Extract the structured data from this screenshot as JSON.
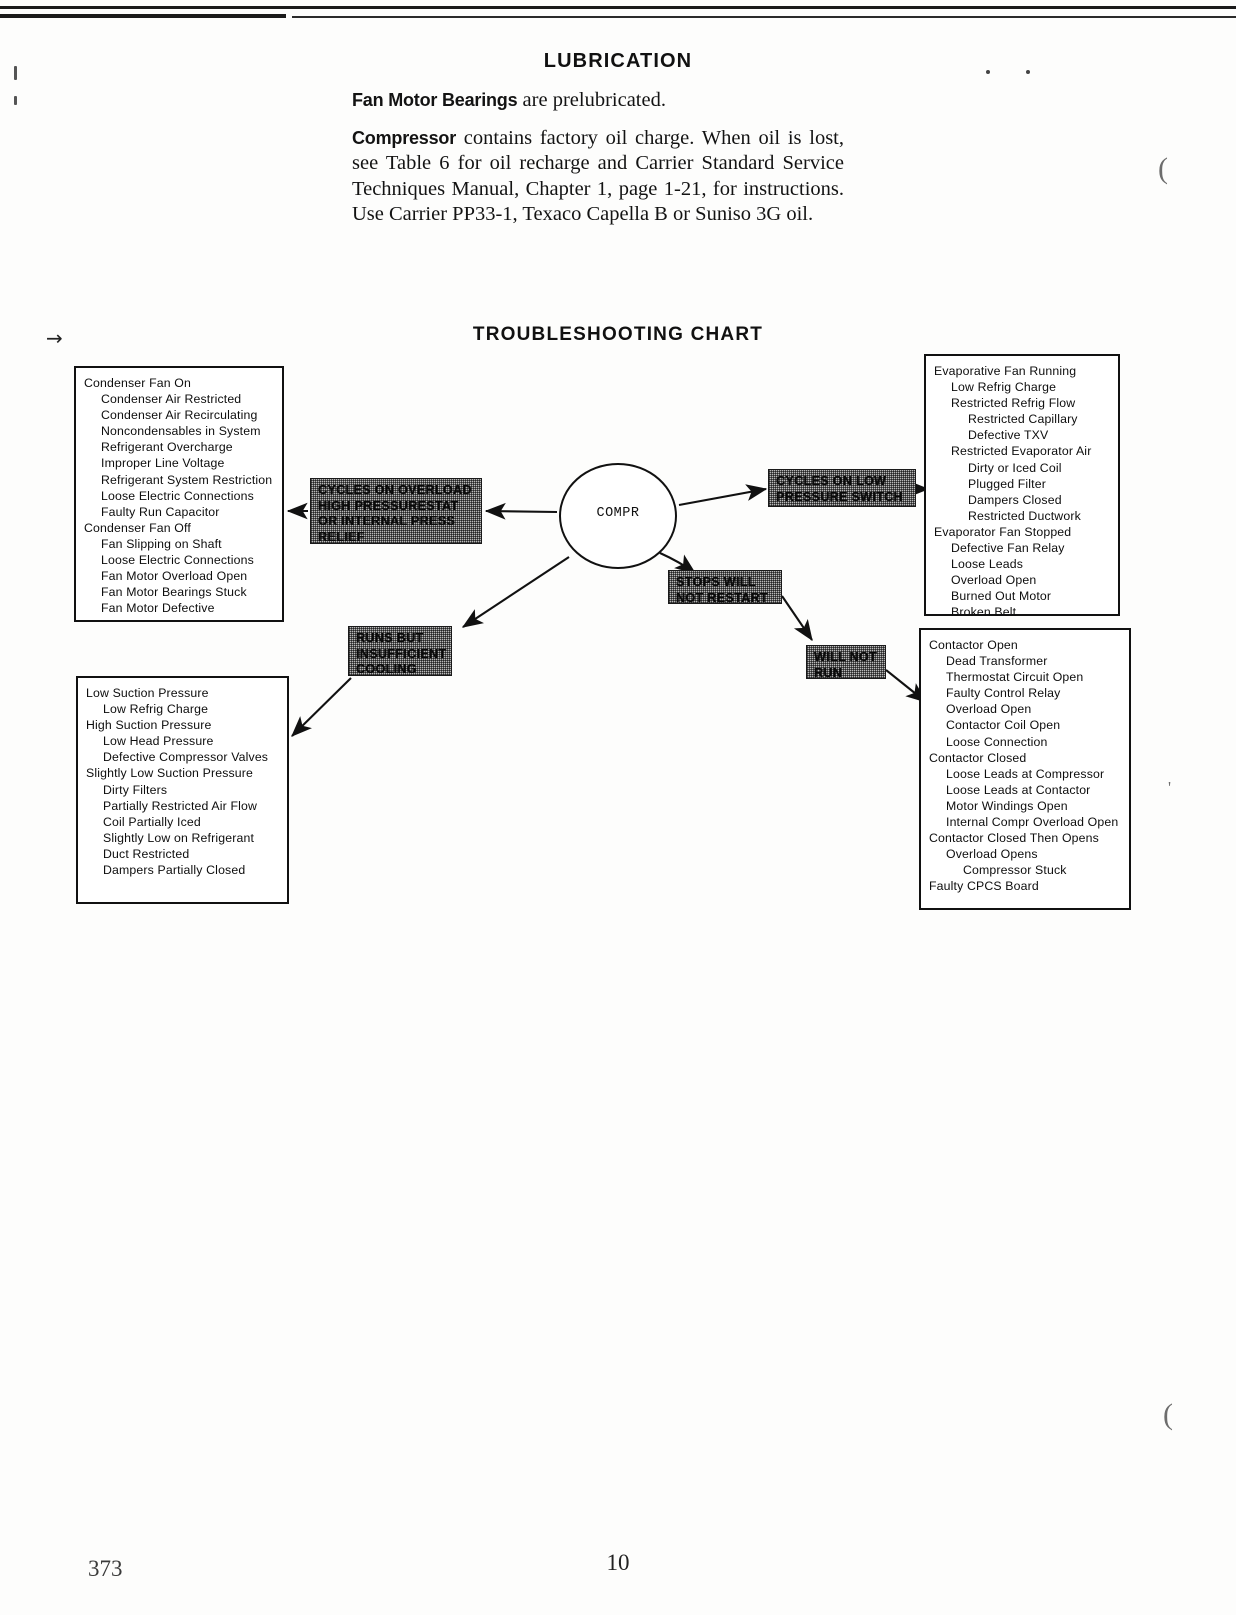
{
  "document": {
    "section_title": "LUBRICATION",
    "paragraphs": [
      {
        "lead": "Fan Motor Bearings",
        "text": " are prelubricated."
      },
      {
        "lead": "Compressor",
        "text": " contains factory oil charge. When oil is lost, see Table 6 for oil recharge and Carrier Standard Service Techniques Manual, Chapter 1, page 1-21, for instructions. Use Carrier PP33-1, Texaco Capella B or Suniso 3G oil."
      }
    ],
    "footer": {
      "left_folio": "373",
      "center_folio": "10"
    }
  },
  "chart": {
    "title": "TROUBLESHOOTING CHART",
    "center_node": "COMPR",
    "callouts": {
      "cycles_on_overload": "CYCLES ON OVERLOAD\nHIGH PRESSURESTAT\nOR INTERNAL PRESS\nRELIEF",
      "cycles_on_low_pressure": "CYCLES ON LOW\nPRESSURE SWITCH",
      "stops_will_not_restart": "STOPS WILL\nNOT RESTART",
      "runs_but_insufficient_cooling": "RUNS BUT\nINSUFFICIENT\nCOOLING",
      "will_not_run": "WILL NOT\nRUN"
    },
    "boxes": {
      "condenser_fan": {
        "name": "Condenser Fan",
        "lines": [
          {
            "indent": 0,
            "text": "Condenser Fan On"
          },
          {
            "indent": 1,
            "text": "Condenser Air Restricted"
          },
          {
            "indent": 1,
            "text": "Condenser Air Recirculating"
          },
          {
            "indent": 1,
            "text": "Noncondensables in System"
          },
          {
            "indent": 1,
            "text": "Refrigerant Overcharge"
          },
          {
            "indent": 1,
            "text": "Improper Line Voltage"
          },
          {
            "indent": 1,
            "text": "Refrigerant System Restriction"
          },
          {
            "indent": 1,
            "text": "Loose Electric Connections"
          },
          {
            "indent": 1,
            "text": "Faulty Run Capacitor"
          },
          {
            "indent": 0,
            "text": "Condenser Fan Off"
          },
          {
            "indent": 1,
            "text": "Fan Slipping on Shaft"
          },
          {
            "indent": 1,
            "text": "Loose Electric Connections"
          },
          {
            "indent": 1,
            "text": "Fan Motor Overload Open"
          },
          {
            "indent": 1,
            "text": "Fan Motor Bearings Stuck"
          },
          {
            "indent": 1,
            "text": "Fan Motor Defective"
          }
        ]
      },
      "evaporator_fan": {
        "name": "Evaporative Fan",
        "lines": [
          {
            "indent": 0,
            "text": "Evaporative Fan Running"
          },
          {
            "indent": 1,
            "text": "Low Refrig Charge"
          },
          {
            "indent": 1,
            "text": "Restricted Refrig Flow"
          },
          {
            "indent": 2,
            "text": "Restricted Capillary"
          },
          {
            "indent": 2,
            "text": "Defective TXV"
          },
          {
            "indent": 1,
            "text": "Restricted Evaporator Air"
          },
          {
            "indent": 2,
            "text": "Dirty or Iced Coil"
          },
          {
            "indent": 2,
            "text": "Plugged Filter"
          },
          {
            "indent": 2,
            "text": "Dampers Closed"
          },
          {
            "indent": 2,
            "text": "Restricted Ductwork"
          },
          {
            "indent": 0,
            "text": "Evaporator Fan Stopped"
          },
          {
            "indent": 1,
            "text": "Defective Fan Relay"
          },
          {
            "indent": 1,
            "text": "Loose Leads"
          },
          {
            "indent": 1,
            "text": "Overload Open"
          },
          {
            "indent": 1,
            "text": "Burned Out Motor"
          },
          {
            "indent": 1,
            "text": "Broken Belt"
          }
        ]
      },
      "suction_pressure": {
        "name": "Suction Pressure",
        "lines": [
          {
            "indent": 0,
            "text": "Low Suction Pressure"
          },
          {
            "indent": 1,
            "text": "Low Refrig Charge"
          },
          {
            "indent": 0,
            "text": "High Suction Pressure"
          },
          {
            "indent": 1,
            "text": "Low Head Pressure"
          },
          {
            "indent": 1,
            "text": "Defective Compressor Valves"
          },
          {
            "indent": 0,
            "text": "Slightly Low Suction Pressure"
          },
          {
            "indent": 1,
            "text": "Dirty Filters"
          },
          {
            "indent": 1,
            "text": "Partially Restricted Air Flow"
          },
          {
            "indent": 1,
            "text": "Coil Partially Iced"
          },
          {
            "indent": 1,
            "text": "Slightly Low on Refrigerant"
          },
          {
            "indent": 1,
            "text": "Duct Restricted"
          },
          {
            "indent": 1,
            "text": "Dampers Partially Closed"
          }
        ]
      },
      "contactor": {
        "name": "Contactor",
        "lines": [
          {
            "indent": 0,
            "text": "Contactor Open"
          },
          {
            "indent": 1,
            "text": "Dead Transformer"
          },
          {
            "indent": 1,
            "text": "Thermostat Circuit Open"
          },
          {
            "indent": 1,
            "text": "Faulty Control Relay"
          },
          {
            "indent": 1,
            "text": "Overload Open"
          },
          {
            "indent": 1,
            "text": "Contactor Coil Open"
          },
          {
            "indent": 1,
            "text": "Loose Connection"
          },
          {
            "indent": 0,
            "text": "Contactor Closed"
          },
          {
            "indent": 1,
            "text": "Loose Leads at Compressor"
          },
          {
            "indent": 1,
            "text": "Loose Leads at Contactor"
          },
          {
            "indent": 1,
            "text": "Motor Windings Open"
          },
          {
            "indent": 1,
            "text": "Internal Compr Overload Open"
          },
          {
            "indent": 0,
            "text": "Contactor Closed Then Opens"
          },
          {
            "indent": 1,
            "text": "Overload Opens"
          },
          {
            "indent": 2,
            "text": "Compressor Stuck"
          },
          {
            "indent": 0,
            "text": "Faulty CPCS Board"
          }
        ]
      }
    }
  }
}
